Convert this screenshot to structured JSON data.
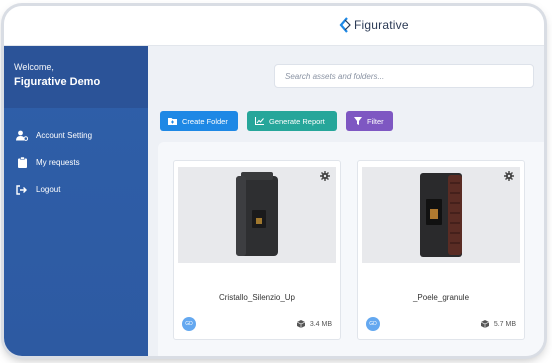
{
  "header": {
    "logo_text": "Figurative"
  },
  "sidebar": {
    "welcome": "Welcome,",
    "user_name": "Figurative Demo",
    "items": [
      {
        "label": "Account Setting",
        "icon": "user-gear-icon"
      },
      {
        "label": "My requests",
        "icon": "clipboard-icon"
      },
      {
        "label": "Logout",
        "icon": "logout-icon"
      }
    ]
  },
  "search": {
    "placeholder": "Search assets and folders..."
  },
  "toolbar": {
    "create_folder": "Create Folder",
    "generate_report": "Generate Report",
    "filter": "Filter"
  },
  "assets": [
    {
      "name": "Cristallo_Silenzio_Up",
      "size": "3.4 MB",
      "avatar": "GD"
    },
    {
      "name": "_Poele_granule",
      "size": "5.7 MB",
      "avatar": "GD"
    }
  ],
  "colors": {
    "sidebar": "#2f5fa9",
    "create_button": "#1e88e5",
    "report_button": "#26a69a",
    "filter_button": "#7e57c2"
  }
}
